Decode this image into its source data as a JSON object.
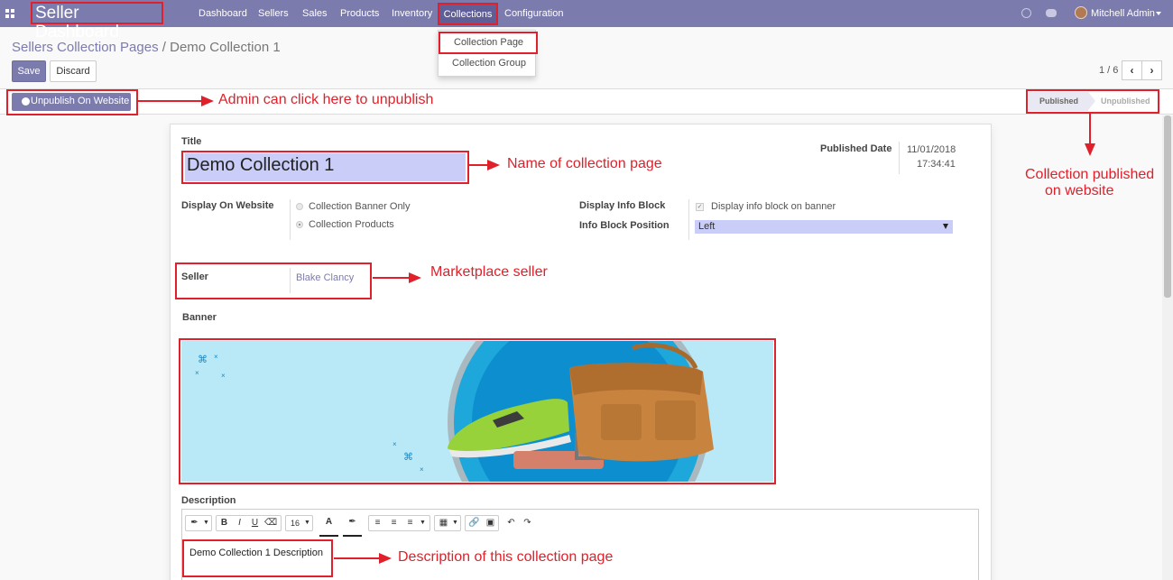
{
  "navbar": {
    "brand": "Seller Dashboard",
    "menu": [
      "Dashboard",
      "Sellers",
      "Sales",
      "Products",
      "Inventory",
      "Collections",
      "Configuration"
    ],
    "user_name": "Mitchell Admin",
    "color": "#7c7bad"
  },
  "dropdown": {
    "items": [
      "Collection Page",
      "Collection Group"
    ]
  },
  "control_panel": {
    "breadcrumb_parent": "Sellers Collection Pages",
    "breadcrumb_sep": "/",
    "breadcrumb_current": "Demo Collection 1",
    "save_label": "Save",
    "discard_label": "Discard",
    "pager": "1 / 6"
  },
  "statusbar": {
    "unpublish_label": "Unpublish On Website",
    "stages": [
      "Published",
      "Unpublished"
    ],
    "current_stage": "Published"
  },
  "form": {
    "title_label": "Title",
    "title_value": "Demo Collection 1",
    "published_date_label": "Published Date",
    "published_date": "11/01/2018",
    "published_time": "17:34:41",
    "display_on_website_label": "Display On Website",
    "display_options": [
      "Collection Banner Only",
      "Collection Products"
    ],
    "display_selected": "Collection Products",
    "display_info_block_label": "Display Info Block",
    "display_info_block_text": "Display info block on banner",
    "info_block_position_label": "Info Block Position",
    "info_block_position_value": "Left",
    "seller_label": "Seller",
    "seller_value": "Blake Clancy",
    "banner_label": "Banner",
    "description_label": "Description",
    "description_value": "Demo Collection 1 Description",
    "font_size": "16"
  },
  "annotations": {
    "unpublish": "Admin can click here to unpublish",
    "title": "Name of collection page",
    "status_line1": "Collection published",
    "status_line2": "on website",
    "seller": "Marketplace seller",
    "description": "Description of this collection page",
    "color": "#e0202a"
  }
}
